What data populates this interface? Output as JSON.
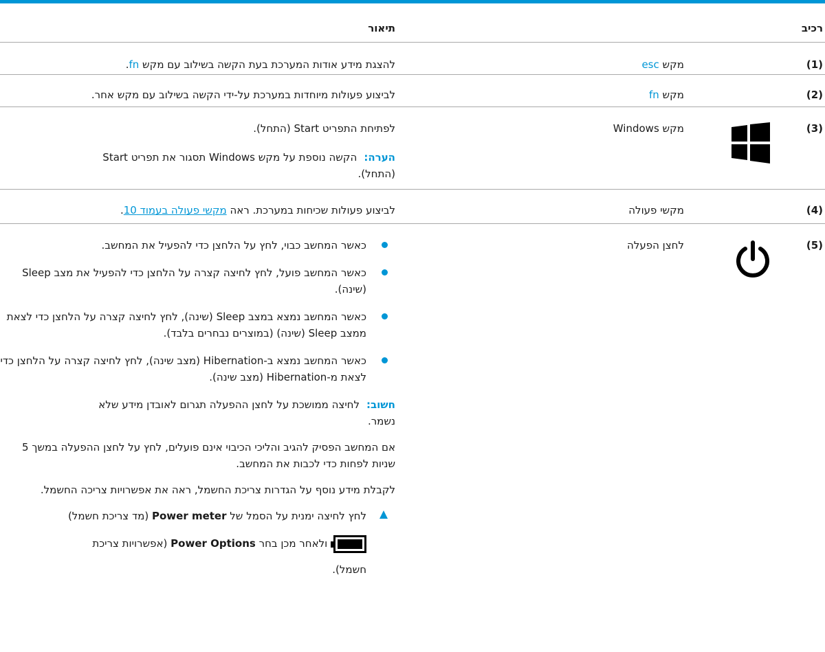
{
  "header": {
    "component": "רכיב",
    "description": "תיאור"
  },
  "rows": [
    {
      "num": "(1)",
      "comp_prefix": "מקש",
      "comp_key": "esc",
      "desc_text": "להצגת מידע אודות המערכת בעת הקשה בשילוב עם מקש",
      "desc_key": "fn",
      "desc_end": "."
    },
    {
      "num": "(2)",
      "comp_prefix": "מקש",
      "comp_key": "fn",
      "desc": "לביצוע פעולות מיוחדות במערכת על-ידי הקשה בשילוב עם מקש אחר."
    },
    {
      "num": "(3)",
      "comp": "מקש Windows",
      "icon": "windows-logo-icon",
      "desc": "לפתיחת התפריט Start (התחל).",
      "note_label": "הערה:",
      "note_text": "הקשה נוספת על מקש Windows תסגור את תפריט Start (התחל)."
    },
    {
      "num": "(4)",
      "comp": "מקשי פעולה",
      "desc_text": "לביצוע פעולות שכיחות במערכת. ראה",
      "desc_link": "מקשי פעולה בעמוד 10",
      "desc_end": "."
    },
    {
      "num": "(5)",
      "comp": "לחצן הפעלה",
      "icon": "power-icon",
      "bullets": [
        "כאשר המחשב כבוי, לחץ על הלחצן כדי להפעיל את המחשב.",
        "כאשר המחשב פועל, לחץ לחיצה קצרה על הלחצן כדי להפעיל את מצב Sleep (שינה).",
        "כאשר המחשב נמצא במצב Sleep (שינה), לחץ לחיצה קצרה על הלחצן כדי לצאת ממצב Sleep (שינה) (במוצרים נבחרים בלבד).",
        "כאשר המחשב נמצא ב-Hibernation (מצב שינה), לחץ לחיצה קצרה על הלחצן כדי לצאת מ-Hibernation (מצב שינה)."
      ],
      "important_label": "חשוב:",
      "important_text": "לחיצה ממושכת על לחצן ההפעלה תגרום לאובדן מידע שלא נשמר.",
      "para1": "אם המחשב הפסיק להגיב והליכי הכיבוי אינם פועלים, לחץ על לחצן ההפעלה במשך 5 שניות לפחות כדי לכבות את המחשב.",
      "para2": "לקבלת מידע נוסף על הגדרות צריכת החשמל, ראה את אפשרויות צריכה החשמל.",
      "step_a": "לחץ לחיצה ימנית על הסמל של",
      "step_b": "Power meter",
      "step_c": "(מד צריכת חשמל)",
      "step_d": "ולאחר מכן בחר",
      "step_e": "Power Options",
      "step_f": "(אפשרויות צריכת",
      "step_g": "חשמל).",
      "battery_icon": "battery-icon"
    }
  ],
  "colors": {
    "accent": "#0096d6",
    "rule": "#a9a9a9"
  }
}
